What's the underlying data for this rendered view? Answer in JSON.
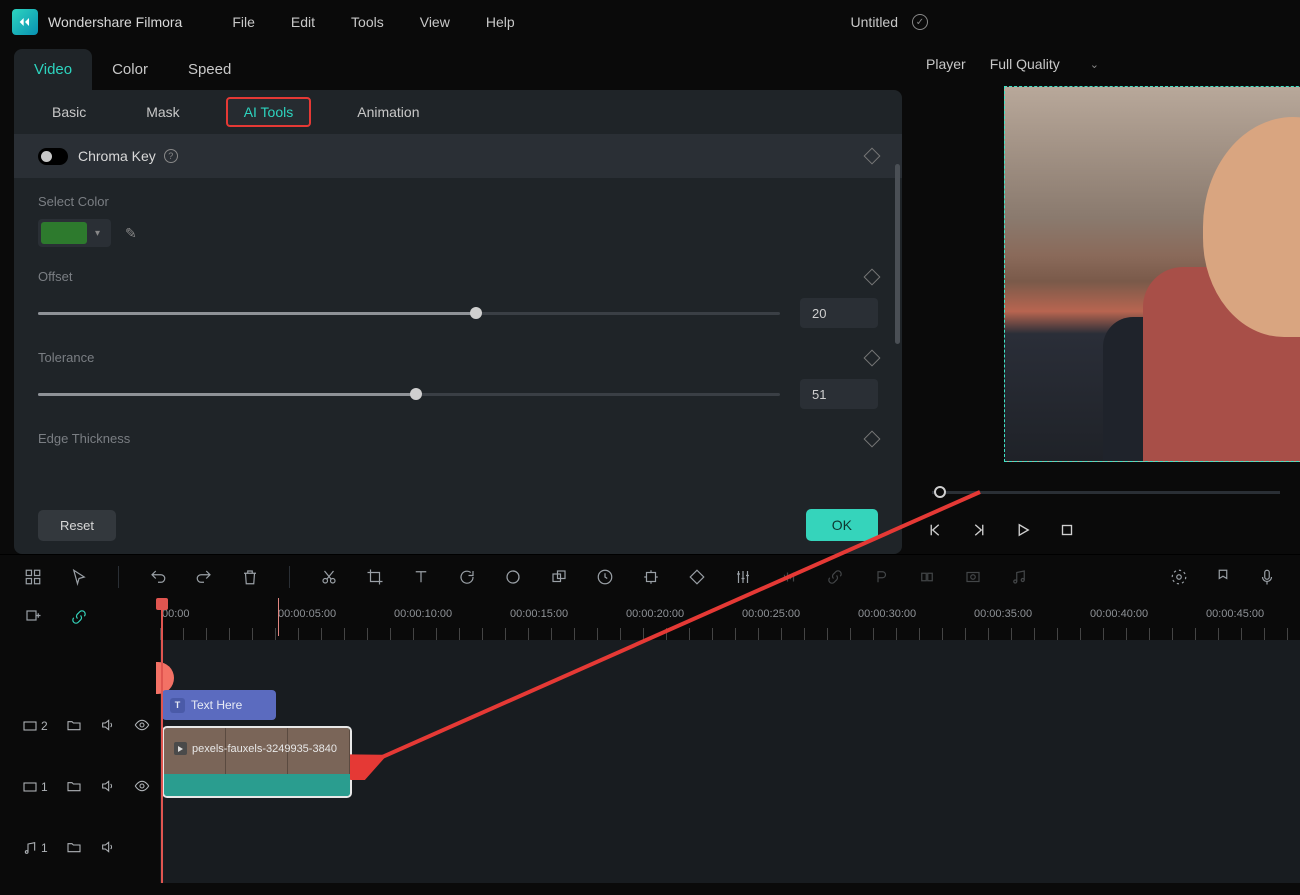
{
  "app": {
    "name": "Wondershare Filmora"
  },
  "menu": {
    "file": "File",
    "edit": "Edit",
    "tools": "Tools",
    "view": "View",
    "help": "Help"
  },
  "project": {
    "title": "Untitled"
  },
  "tabs": {
    "primary": {
      "video": "Video",
      "color": "Color",
      "speed": "Speed"
    },
    "sub": {
      "basic": "Basic",
      "mask": "Mask",
      "ai_tools": "AI Tools",
      "animation": "Animation"
    }
  },
  "chroma": {
    "label": "Chroma Key",
    "select_color": "Select Color",
    "color_hex": "#2d7a2d",
    "offset": {
      "label": "Offset",
      "value": "20",
      "pct": 59
    },
    "tolerance": {
      "label": "Tolerance",
      "value": "51",
      "pct": 51
    },
    "edge": {
      "label": "Edge Thickness"
    }
  },
  "buttons": {
    "reset": "Reset",
    "ok": "OK"
  },
  "player": {
    "label": "Player",
    "quality": "Full Quality"
  },
  "timeline": {
    "marks": [
      "00:00",
      "00:00:05:00",
      "00:00:10:00",
      "00:00:15:00",
      "00:00:20:00",
      "00:00:25:00",
      "00:00:30:00",
      "00:00:35:00",
      "00:00:40:00",
      "00:00:45:00"
    ],
    "text_clip": "Text Here",
    "video_clip": "pexels-fauxels-3249935-3840",
    "tracks": {
      "v2": "2",
      "v1": "1",
      "a1": "1"
    }
  }
}
